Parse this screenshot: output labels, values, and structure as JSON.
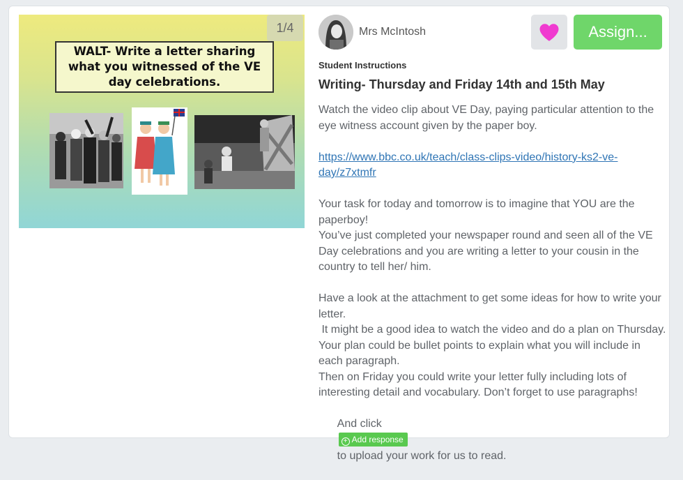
{
  "slide": {
    "counter": "1/4",
    "walt_text": "WALT- Write a letter sharing what you witnessed of the VE day celebrations."
  },
  "post": {
    "teacher_name": "Mrs McIntosh",
    "assign_label": "Assign...",
    "student_instructions_label": "Student Instructions",
    "title": "Writing- Thursday and Friday 14th and 15th May",
    "para1": "Watch the video clip about VE Day, paying particular attention to the eye witness account given by the paper boy.",
    "link": "https://www.bbc.co.uk/teach/class-clips-video/history-ks2-ve-day/z7xtmfr",
    "para2": "Your task for today and tomorrow is to imagine that YOU are the paperboy!\nYou’ve just completed your newspaper round and seen all of the VE Day celebrations and you are writing a letter to your cousin in the country to tell her/ him.",
    "para3": "Have a look at the attachment to get some ideas for how to write your letter.\n It might be a good idea to watch the video and do a plan on Thursday. Your plan could be bullet points to explain what you will include in each paragraph.\nThen on Friday you could write your letter fully including lots of interesting detail and vocabulary. Don’t forget to use paragraphs!",
    "and_click": "And click",
    "add_response_label": "Add response",
    "upload_text": "to upload your work for us to read."
  },
  "colors": {
    "heart": "#f03ad0",
    "assign": "#6fd66a",
    "add_response": "#59c94f",
    "link": "#2f75b5"
  },
  "icons": [
    "heart-icon",
    "plus-circle-icon"
  ]
}
